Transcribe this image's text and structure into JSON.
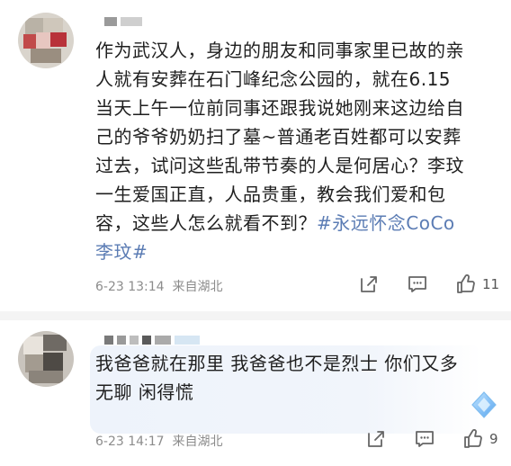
{
  "comment1": {
    "text_lines": [
      "作为武汉人，身边的朋友和同事家里已故的亲",
      "人就有安葬在石门峰纪念公园的，就在6.15",
      "当天上午一位前同事还跟我说她刚来这边给自",
      "己的爷爷奶奶扫了墓~普通老百姓都可以安葬",
      "过去，试问这些乱带节奏的人是何居心？李玟",
      "一生爱国正直，人品贵重，教会我们爱和包",
      "容，这些人怎么就看不到？"
    ],
    "hashtag_part1": "#永远怀念CoCo",
    "hashtag_part2": "李玟#",
    "timestamp": "6-23 13:14",
    "location": "来自湖北",
    "like_count": "11"
  },
  "comment2": {
    "text_lines": [
      "我爸爸就在那里 我爸爸也不是烈士 你们又多",
      "无聊 闲得慌"
    ],
    "timestamp": "6-23 14:17",
    "location": "来自湖北",
    "like_count": "9"
  },
  "icons": {
    "share": "share-icon",
    "comment": "comment-icon",
    "like": "thumbs-up-icon",
    "sparkle": "diamond-sparkle-icon"
  },
  "colors": {
    "hashtag": "#5b7cb4",
    "meta": "#8c8c8c",
    "reply_highlight": "#eef3fb"
  }
}
